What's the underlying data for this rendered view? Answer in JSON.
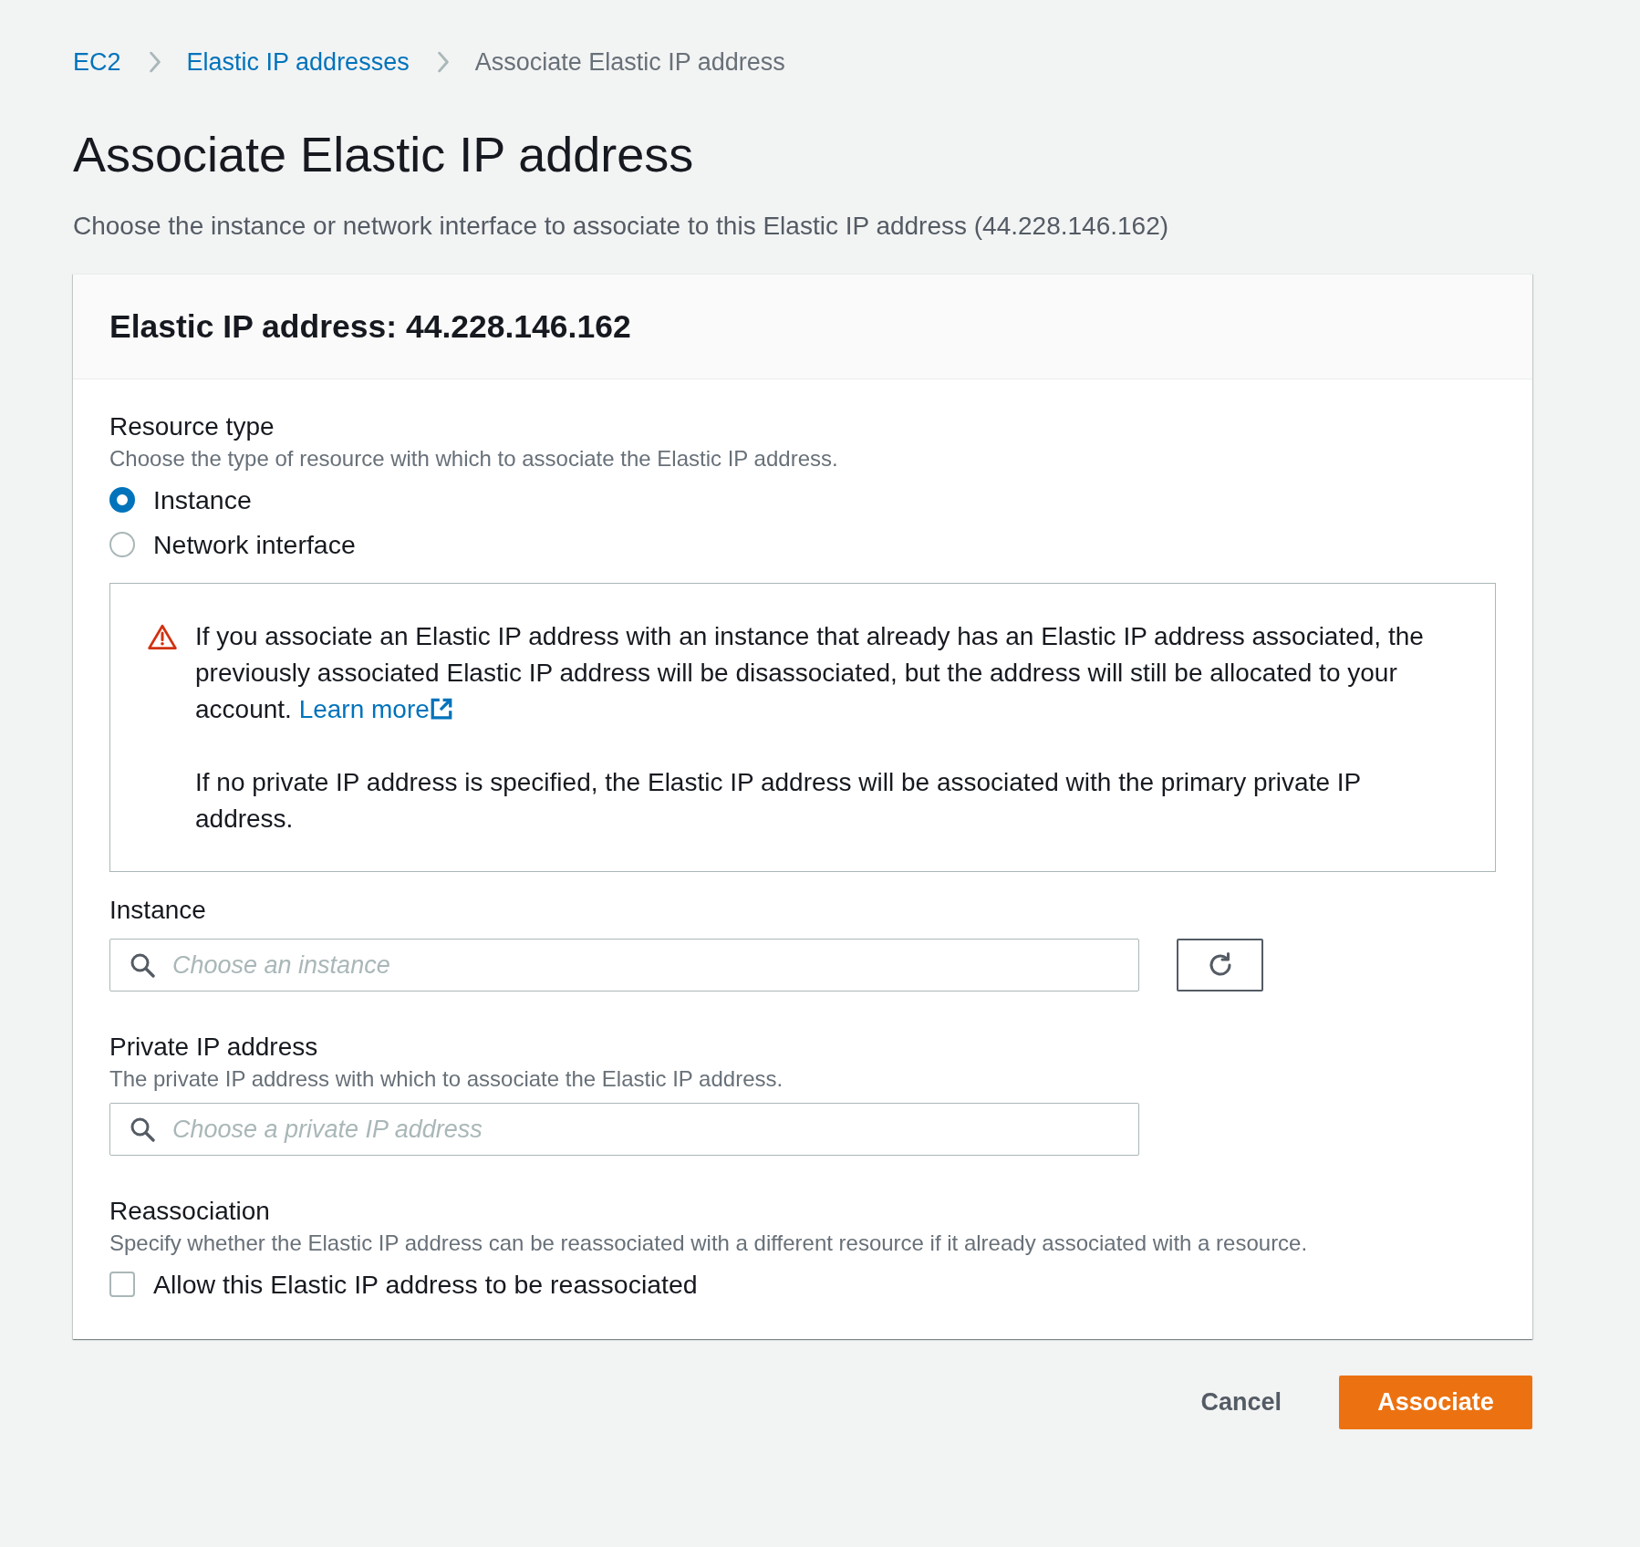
{
  "breadcrumbs": [
    {
      "label": "EC2",
      "kind": "link"
    },
    {
      "label": "Elastic IP addresses",
      "kind": "link"
    },
    {
      "label": "Associate Elastic IP address",
      "kind": "current"
    }
  ],
  "page": {
    "title": "Associate Elastic IP address",
    "description": "Choose the instance or network interface to associate to this Elastic IP address (44.228.146.162)"
  },
  "panel": {
    "title": "Elastic IP address: 44.228.146.162"
  },
  "resource_type": {
    "label": "Resource type",
    "description": "Choose the type of resource with which to associate the Elastic IP address.",
    "options": [
      {
        "label": "Instance",
        "selected": true
      },
      {
        "label": "Network interface",
        "selected": false
      }
    ]
  },
  "alert": {
    "paragraphs": [
      {
        "text": "If you associate an Elastic IP address with an instance that already has an Elastic IP address associated, the previously associated Elastic IP address will be disassociated, but the address will still be allocated to your account.",
        "link": "Learn more"
      },
      {
        "text": "If no private IP address is specified, the Elastic IP address will be associated with the primary private IP address."
      }
    ]
  },
  "instance": {
    "label": "Instance",
    "placeholder": "Choose an instance"
  },
  "private_ip": {
    "label": "Private IP address",
    "description": "The private IP address with which to associate the Elastic IP address.",
    "placeholder": "Choose a private IP address"
  },
  "reassociation": {
    "label": "Reassociation",
    "description": "Specify whether the Elastic IP address can be reassociated with a different resource if it already associated with a resource.",
    "checkbox": {
      "label": "Allow this Elastic IP address to be reassociated",
      "checked": false
    }
  },
  "buttons": [
    {
      "label": "Cancel",
      "kind": "link"
    },
    {
      "label": "Associate",
      "kind": "primary"
    }
  ]
}
